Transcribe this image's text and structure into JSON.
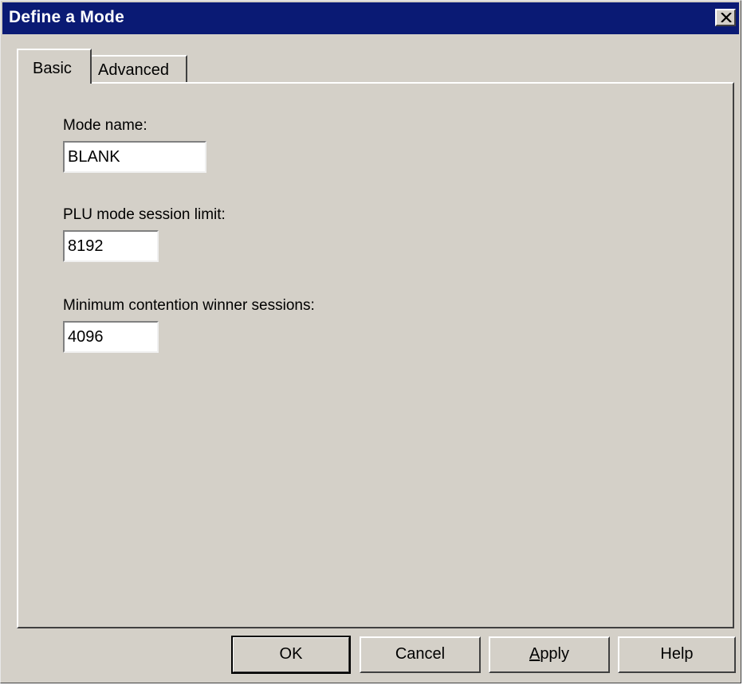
{
  "window": {
    "title": "Define a Mode"
  },
  "tabs": [
    {
      "label": "Basic",
      "selected": true
    },
    {
      "label": "Advanced",
      "selected": false
    }
  ],
  "form": {
    "mode_name": {
      "label": "Mode name:",
      "value": "BLANK"
    },
    "plu_limit": {
      "label": "PLU mode session limit:",
      "value": "8192"
    },
    "min_winner": {
      "label": "Minimum contention winner sessions:",
      "value": "4096"
    }
  },
  "buttons": {
    "ok": "OK",
    "cancel": "Cancel",
    "apply_first": "A",
    "apply_rest": "pply",
    "help": "Help"
  },
  "colors": {
    "titlebar": "#0a1a74",
    "face": "#d4d0c8"
  },
  "icons": {
    "close": "close-icon"
  }
}
